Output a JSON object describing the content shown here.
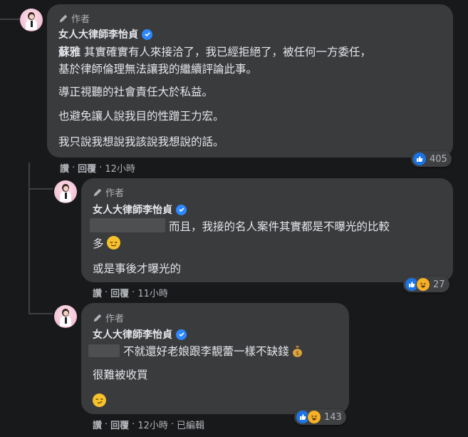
{
  "comments": [
    {
      "author_tag": "作者",
      "author_name": "女人大律師李怡貞",
      "mention": "蘇雅",
      "line1": " 其實確實有人來接洽了，我已經拒絕了，被任何一方委任，",
      "line2": "基於律師倫理無法讓我的繼續評論此事。",
      "line3": "導正視聽的社會責任大於私益。",
      "line4": "也避免讓人說我目的性蹭王力宏。",
      "line5": "我只說我想說我該說我想說的話。",
      "reaction_count": "405",
      "action_read": "讚",
      "action_reply": "回覆",
      "time": "12小時"
    },
    {
      "author_tag": "作者",
      "author_name": "女人大律師李怡貞",
      "line1": "而且，我接的名人案件其實都是不曝光的比較",
      "line2": "多",
      "line3": "或是事後才曝光的",
      "reaction_count": "27",
      "action_read": "讚",
      "action_reply": "回覆",
      "time": "11小時"
    },
    {
      "author_tag": "作者",
      "author_name": "女人大律師李怡貞",
      "line1": "不就還好老娘跟李靚蕾一樣不缺錢",
      "line2": "很難被收買",
      "reaction_count": "143",
      "action_read": "讚",
      "action_reply": "回覆",
      "time": "12小時",
      "edited": "已編輯"
    }
  ],
  "separator": "·",
  "colors": {
    "background": "#18191a",
    "bubble": "#3a3b3c",
    "text": "#e4e6eb",
    "secondary_text": "#b0b3b8",
    "like_blue": "#1b74e4",
    "verified_blue": "#2d88ff",
    "haha_yellow": "#f7b125"
  },
  "icons": [
    "pencil-icon",
    "verified-badge-icon",
    "like-reaction-icon",
    "haha-reaction-icon",
    "relieved-face-emoji",
    "smirk-face-emoji",
    "money-bag-emoji"
  ]
}
